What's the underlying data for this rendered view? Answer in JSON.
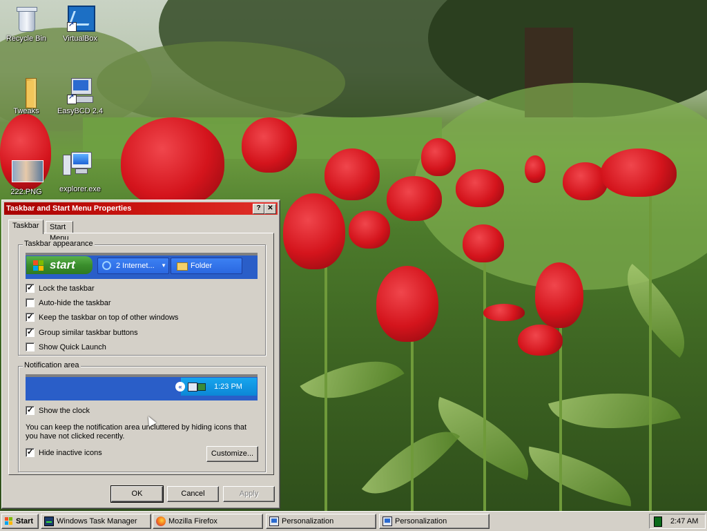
{
  "desktop": {
    "icons": [
      {
        "label": "Recycle Bin",
        "icon": "recycle-bin-icon"
      },
      {
        "label": "VirtualBox",
        "icon": "virtualbox-icon"
      },
      {
        "label": "Tweaks",
        "icon": "folder-icon"
      },
      {
        "label": "EasyBCD 2.4",
        "icon": "easybcd-icon"
      },
      {
        "label": "222.PNG",
        "icon": "image-file-icon"
      },
      {
        "label": "explorer.exe",
        "icon": "computer-icon"
      }
    ]
  },
  "dialog": {
    "title": "Taskbar and Start Menu Properties",
    "help_glyph": "?",
    "close_glyph": "✕",
    "tabs": [
      "Taskbar",
      "Start Menu"
    ],
    "active_tab": "Taskbar",
    "appearance": {
      "title": "Taskbar appearance",
      "preview": {
        "start_label": "start",
        "buttons": [
          {
            "label": "2 Internet...",
            "icon": "ie-icon"
          },
          {
            "label": "Folder",
            "icon": "folder-icon"
          }
        ]
      },
      "options": [
        {
          "label": "Lock the taskbar",
          "checked": true
        },
        {
          "label": "Auto-hide the taskbar",
          "checked": false
        },
        {
          "label": "Keep the taskbar on top of other windows",
          "checked": true
        },
        {
          "label": "Group similar taskbar buttons",
          "checked": true
        },
        {
          "label": "Show Quick Launch",
          "checked": false
        }
      ]
    },
    "notification": {
      "title": "Notification area",
      "preview_time": "1:23 PM",
      "show_clock": {
        "label": "Show the clock",
        "checked": true
      },
      "description": "You can keep the notification area uncluttered by hiding icons that you have not clicked recently.",
      "hide_inactive": {
        "label": "Hide inactive icons",
        "checked": true
      },
      "customize_label": "Customize..."
    },
    "buttons": {
      "ok": "OK",
      "cancel": "Cancel",
      "apply": "Apply"
    }
  },
  "taskbar": {
    "start_label": "Start",
    "items": [
      {
        "label": "Windows Task Manager",
        "icon": "task-manager-icon"
      },
      {
        "label": "Mozilla Firefox",
        "icon": "firefox-icon"
      },
      {
        "label": "Personalization",
        "icon": "personalization-icon"
      },
      {
        "label": "Personalization",
        "icon": "personalization-icon"
      }
    ],
    "clock": "2:47 AM"
  },
  "colors": {
    "title_bar": "#c8140e",
    "dialog_face": "#d4d0c8",
    "xp_taskbar_blue": "#2a5ec8",
    "xp_start_green": "#3a8e2c"
  }
}
